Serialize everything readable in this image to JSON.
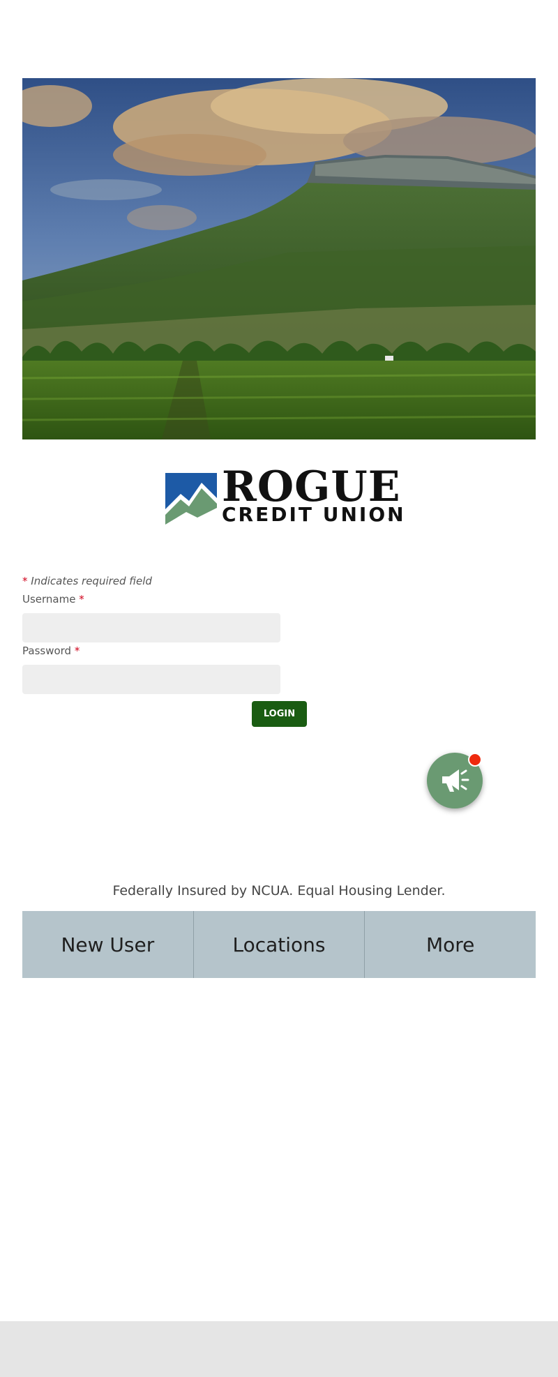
{
  "brand": {
    "logo_word": "ROGUE",
    "logo_sub": "CREDIT UNION",
    "logo_tm": "™",
    "logo_icon": "mountain-logo-icon",
    "colors": {
      "logo_blue": "#1d5aa6",
      "logo_green": "#6a9a72"
    }
  },
  "hero": {
    "icon": "mountain-vineyard-photo"
  },
  "form": {
    "required_star": "*",
    "required_note": "Indicates required field",
    "username_label": "Username",
    "username_value": "",
    "password_label": "Password",
    "password_value": "",
    "login_label": "LOGIN",
    "login_color": "#1a5c12"
  },
  "announcements": {
    "icon": "megaphone-icon",
    "badge_color": "#ee2a0e",
    "button_color": "#6a9a72"
  },
  "footer": {
    "note": "Federally Insured by NCUA. Equal Housing Lender."
  },
  "bottom_nav": {
    "items": [
      {
        "label": "New User"
      },
      {
        "label": "Locations"
      },
      {
        "label": "More"
      }
    ],
    "background": "#b5c4cb"
  }
}
